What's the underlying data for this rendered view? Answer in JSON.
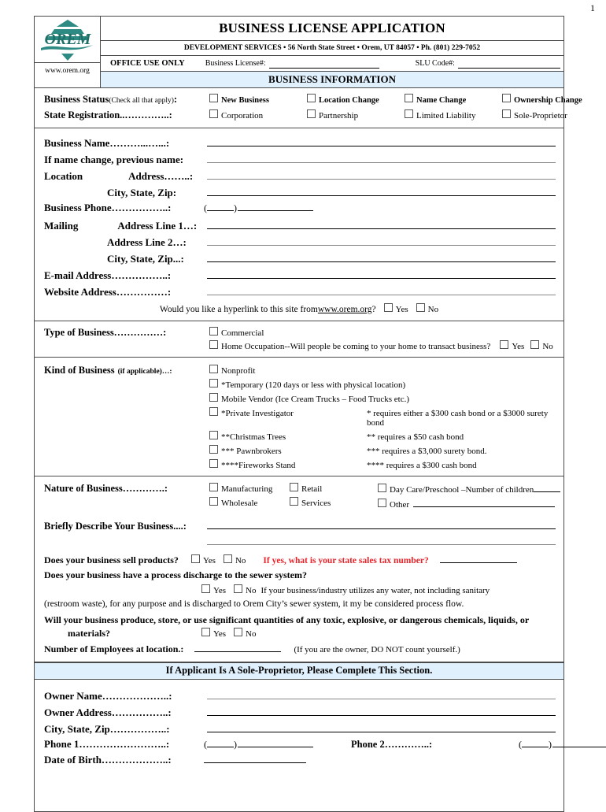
{
  "page_number": "1",
  "header": {
    "logo_text": "OREM",
    "website": "www.orem.org",
    "title": "BUSINESS LICENSE APPLICATION",
    "subtitle": "DEVELOPMENT SERVICES  •  56 North State Street  •  Orem, UT 84057  •  Ph. (801) 229-7052",
    "office_use_label": "OFFICE USE ONLY",
    "business_license_label": "Business License#:",
    "slu_code_label": "SLU Code#:",
    "banner": "BUSINESS INFORMATION"
  },
  "status": {
    "label": "Business Status",
    "label_note": "(Check all that apply)",
    "options": [
      "New Business",
      "Location Change",
      "Name Change",
      "Ownership Change"
    ],
    "registration_label": "State Registration..…………..:",
    "registration_options": [
      "Corporation",
      "Partnership",
      "Limited Liability",
      "Sole-Proprietor"
    ]
  },
  "contact": {
    "business_name": "Business Name………...…...:",
    "previous_name": "If name change, previous name:",
    "location": "Location",
    "location_address": "Address……..:",
    "location_city": "City, State, Zip:",
    "business_phone": "Business Phone……………..:",
    "mailing": "Mailing",
    "mailing_line1": "Address Line 1…:",
    "mailing_line2": "Address Line 2…:",
    "mailing_city": "City, State, Zip...:",
    "email": "E-mail Address……………..:",
    "website": "Website Address……………:",
    "hyperlink_q_pre": "Would you like a hyperlink to this site from ",
    "hyperlink_url": "www.orem.org",
    "hyperlink_q_post": "?",
    "yes": "Yes",
    "no": "No"
  },
  "type_of_business": {
    "label": "Type of Business……………:",
    "commercial": "Commercial",
    "home_occupation": "Home Occupation--Will people be coming to your home to transact business?",
    "yes": "Yes",
    "no": "No"
  },
  "kind_of_business": {
    "label": "Kind of Business",
    "label_note": "(if applicable)…:",
    "options": [
      {
        "name": "Nonprofit",
        "note": ""
      },
      {
        "name": "*Temporary (120 days or less with physical location)",
        "note": ""
      },
      {
        "name": " Mobile Vendor  (Ice Cream Trucks – Food Trucks etc.)",
        "note": ""
      },
      {
        "name": "*Private Investigator",
        "note": "* requires either a $300 cash bond or a $3000 surety bond"
      },
      {
        "name": "**Christmas Trees",
        "note": "** requires a $50 cash bond"
      },
      {
        "name": "*** Pawnbrokers",
        "note": "*** requires a $3,000 surety bond."
      },
      {
        "name": "****Fireworks Stand",
        "note": "**** requires a $300 cash bond"
      }
    ]
  },
  "nature_of_business": {
    "label": "Nature of Business………….:",
    "col1": [
      "Manufacturing",
      "Wholesale"
    ],
    "col2": [
      "Retail",
      "Services"
    ],
    "daycare": "Day Care/Preschool –Number of children",
    "other": "Other",
    "describe_label": "Briefly Describe Your Business....:"
  },
  "questions": {
    "sell_products": "Does your business sell products?",
    "yes": "Yes",
    "no": "No",
    "sales_tax_red": "If yes, what is your state sales tax number?",
    "sewer_discharge": "Does your business have a process discharge to the sewer system?",
    "sewer_note_1": "If your business/industry utilizes any water, not including sanitary",
    "sewer_note_2": "(restroom waste), for any purpose and is discharged to Orem City’s sewer system, it my be considered process flow.",
    "chemicals": "Will your business produce, store, or use significant quantities of any toxic, explosive, or dangerous chemicals, liquids, or",
    "chemicals_2": "materials?",
    "employees_label": "Number of Employees at location.:",
    "employees_note": "(If you are the owner, DO NOT count yourself.)"
  },
  "sole_prop": {
    "banner": "If Applicant Is A Sole-Proprietor, Please Complete This Section.",
    "owner_name": "Owner Name………………..:",
    "owner_address": "Owner Address……………..:",
    "city_state_zip": "City, State, Zip……………..:",
    "phone1": "Phone 1……………………..:",
    "phone2": "Phone 2…………..:",
    "date_of_birth": "Date of Birth………………..:"
  },
  "colors": {
    "banner_bg": "#e0f0fc",
    "logo_teal": "#2e8b83",
    "alert_red": "#e8232a",
    "border": "#4a4a4a"
  }
}
